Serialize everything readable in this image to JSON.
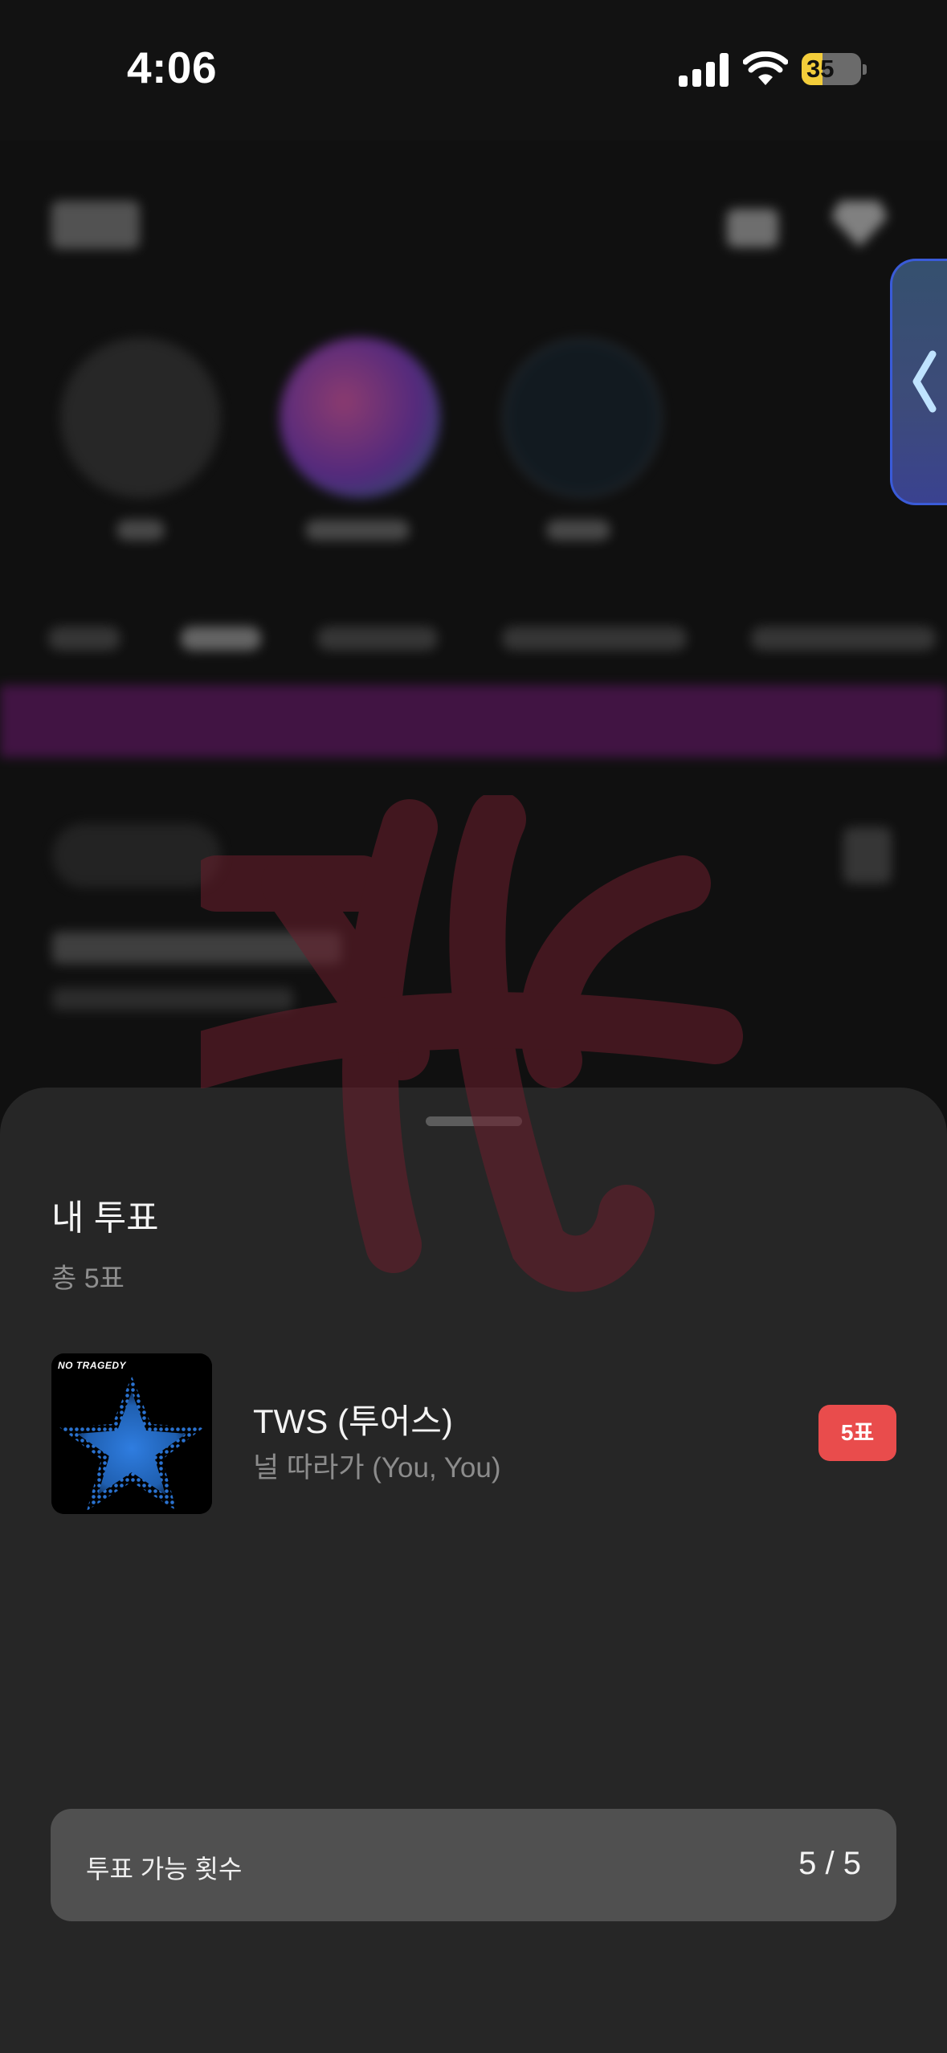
{
  "status_bar": {
    "time": "4:06",
    "battery_level": "35",
    "battery_fill_percent": 35,
    "icons": [
      "cellular-signal-icon",
      "wifi-icon",
      "battery-charging-icon"
    ]
  },
  "side_button": {
    "icon": "chevron-left-icon"
  },
  "sheet": {
    "title": "내 투표",
    "total": "총 5표",
    "items": [
      {
        "artist": "TWS (투어스)",
        "song": "널 따라가 (You, You)",
        "votes": "5표",
        "album_art_text": "NO TRAGEDY"
      }
    ],
    "available": {
      "label": "투표 가능 횟수",
      "value": "5 / 5"
    }
  },
  "colors": {
    "sheet_bg": "#262626",
    "badge_red": "#e94c4c",
    "count_box_bg": "#505050",
    "banner_purple": "#6a186e",
    "side_button_border": "#3a5bd8"
  }
}
